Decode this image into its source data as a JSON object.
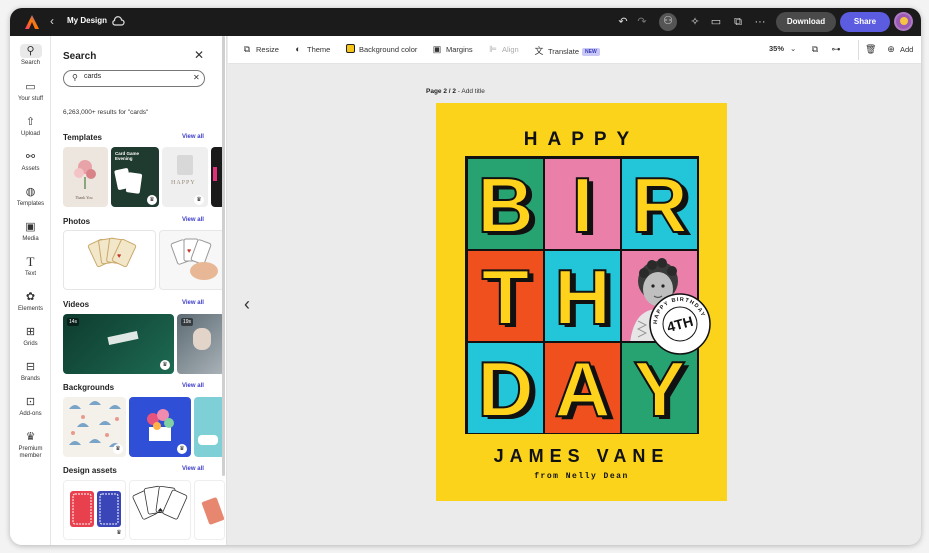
{
  "header": {
    "doc_title": "My Design",
    "download_label": "Download",
    "share_label": "Share"
  },
  "rail": [
    {
      "label": "Search",
      "icon": "search-icon"
    },
    {
      "label": "Your stuff",
      "icon": "folder-icon"
    },
    {
      "label": "Upload",
      "icon": "upload-icon"
    },
    {
      "label": "Assets",
      "icon": "assets-icon"
    },
    {
      "label": "Templates",
      "icon": "templates-icon"
    },
    {
      "label": "Media",
      "icon": "media-icon"
    },
    {
      "label": "Text",
      "icon": "text-icon"
    },
    {
      "label": "Elements",
      "icon": "elements-icon"
    },
    {
      "label": "Grids",
      "icon": "grids-icon"
    },
    {
      "label": "Brands",
      "icon": "brands-icon"
    },
    {
      "label": "Add-ons",
      "icon": "addons-icon"
    },
    {
      "label": "Premium member",
      "icon": "crown-icon"
    }
  ],
  "panel": {
    "title": "Search",
    "search_value": "cards",
    "result_count": "6,263,000+ results for \"cards\"",
    "view_all": "View all",
    "sections": [
      "Templates",
      "Photos",
      "Videos",
      "Backgrounds",
      "Design assets"
    ],
    "template_texts": {
      "game_night": "Card Game Evening",
      "happy": "HAPPY",
      "thank_you": "Thank You"
    },
    "video_durations": [
      "14s",
      "19s"
    ]
  },
  "toolbar": {
    "resize": "Resize",
    "theme": "Theme",
    "background_color": "Background color",
    "margins": "Margins",
    "align": "Align",
    "translate": "Translate",
    "new_badge": "NEW",
    "zoom": "35%",
    "add": "Add"
  },
  "canvas": {
    "page_label_bold": "Page 2 / 2",
    "page_label_rest": " - Add title"
  },
  "poster": {
    "happy": "HAPPY",
    "letters": [
      "B",
      "I",
      "R",
      "T",
      "H",
      "",
      "D",
      "A",
      "Y"
    ],
    "name": "JAMES VANE",
    "from": "from Nelly Dean",
    "seal_big": "4TH",
    "seal_ring": "HAPPY BIRTHDAY",
    "background": "#fbd31b",
    "cell_colors": [
      "#26a371",
      "#ea7fa9",
      "#22c6d8",
      "#f0501e",
      "#22c6d8",
      "#ea7fa9",
      "#22c6d8",
      "#f0501e",
      "#26a371"
    ]
  }
}
